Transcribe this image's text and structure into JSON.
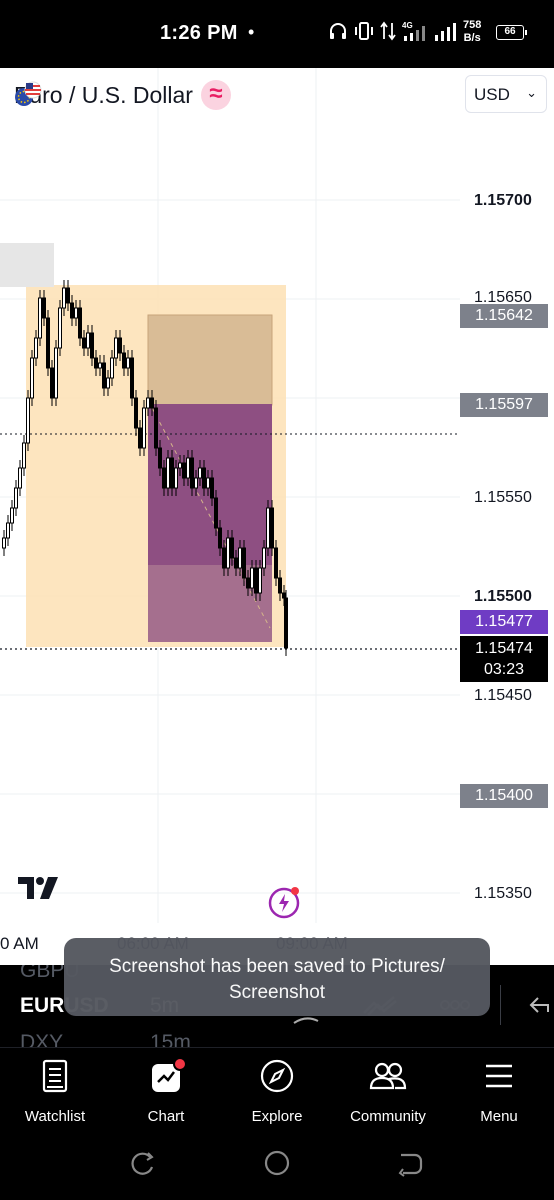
{
  "status": {
    "time": "1:26 PM",
    "dot": "•",
    "net_speed_value": "758",
    "net_speed_unit": "B/s",
    "network": "4G",
    "battery": "66"
  },
  "header": {
    "symbol_title": "Euro / U.S. Dollar",
    "currency_selected": "USD"
  },
  "price_axis": {
    "labels": [
      {
        "text": "1.15700",
        "bold": true
      },
      {
        "text": "1.15550",
        "bold": false
      },
      {
        "text": "1.15500",
        "bold": true
      },
      {
        "text": "1.15450",
        "bold": false
      },
      {
        "text": "1.15350",
        "bold": false
      }
    ],
    "partial_label": "1.15650",
    "tags": {
      "upper": "1.15642",
      "middle": "1.15597",
      "current": "1.15477",
      "last_price": "1.15474",
      "countdown": "03:23",
      "lower": "1.15400"
    }
  },
  "time_axis": {
    "labels": [
      "0 AM",
      "06:00 AM",
      "09:00 AM"
    ]
  },
  "toolbar": {
    "rows": [
      {
        "symbol": "GBPUSD",
        "interval": "",
        "state": "faded"
      },
      {
        "symbol": "EURUSD",
        "interval": "5m",
        "state": "active"
      },
      {
        "symbol": "DXY",
        "interval": "15m",
        "state": "faded"
      }
    ],
    "visible_symbol_prev": "GBPU",
    "visible_symbol_next": "DXY",
    "active_symbol": "EURUSD",
    "active_interval": "5m",
    "next_interval": "15m"
  },
  "toast": {
    "line1": "Screenshot has been saved to  Pictures/",
    "line2": "Screenshot"
  },
  "bottom_nav": [
    {
      "label": "Watchlist",
      "icon": "watchlist-icon"
    },
    {
      "label": "Chart",
      "icon": "chart-icon"
    },
    {
      "label": "Explore",
      "icon": "compass-icon"
    },
    {
      "label": "Community",
      "icon": "community-icon"
    },
    {
      "label": "Menu",
      "icon": "menu-icon"
    }
  ],
  "colors": {
    "accent_purple": "#6f3cc4",
    "zone_orange": "#fde2b8",
    "zone_purple": "#8e4f82",
    "badge_pink": "#e91e63"
  }
}
